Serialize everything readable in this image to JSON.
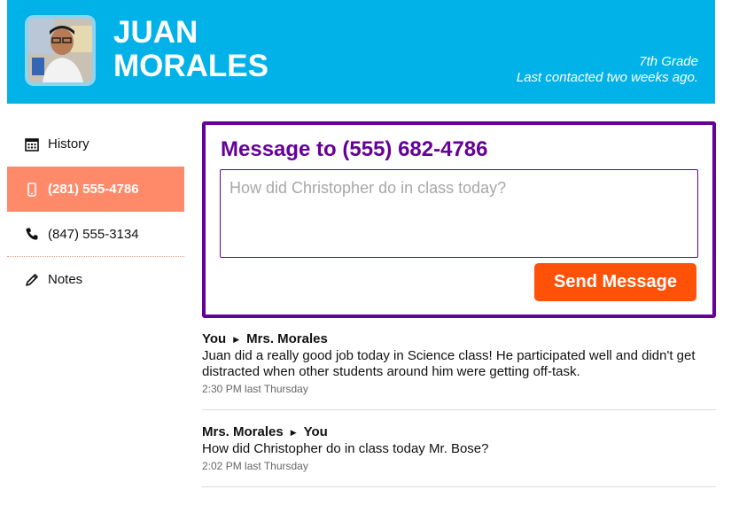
{
  "contact": {
    "name_first": "JUAN",
    "name_last": "MORALES",
    "grade": "7th Grade",
    "last_contacted": "Last contacted two weeks ago."
  },
  "sidebar": {
    "items": [
      {
        "label": "History",
        "icon": "calendar-icon",
        "active": false
      },
      {
        "label": "(281) 555-4786",
        "icon": "mobile-phone-icon",
        "active": true
      },
      {
        "label": "(847) 555-3134",
        "icon": "phone-icon",
        "active": false
      },
      {
        "label": "Notes",
        "icon": "pencil-icon",
        "active": false
      }
    ]
  },
  "compose": {
    "title": "Message to (555) 682-4786",
    "placeholder": "How did Christopher do in class today?",
    "send_label": "Send Message"
  },
  "messages": [
    {
      "from": "You",
      "to": "Mrs. Morales",
      "body": "Juan did a really good job today in Science class! He participated well and didn't get distracted when other students around him were getting off-task.",
      "time": "2:30 PM last Thursday"
    },
    {
      "from": "Mrs. Morales",
      "to": "You",
      "body": "How did Christopher do in class today Mr. Bose?",
      "time": "2:02 PM last Thursday"
    }
  ],
  "colors": {
    "header_bg": "#00b2e8",
    "accent_purple": "#650198",
    "active_item": "#ff8a6a",
    "send_button": "#ff5208"
  }
}
